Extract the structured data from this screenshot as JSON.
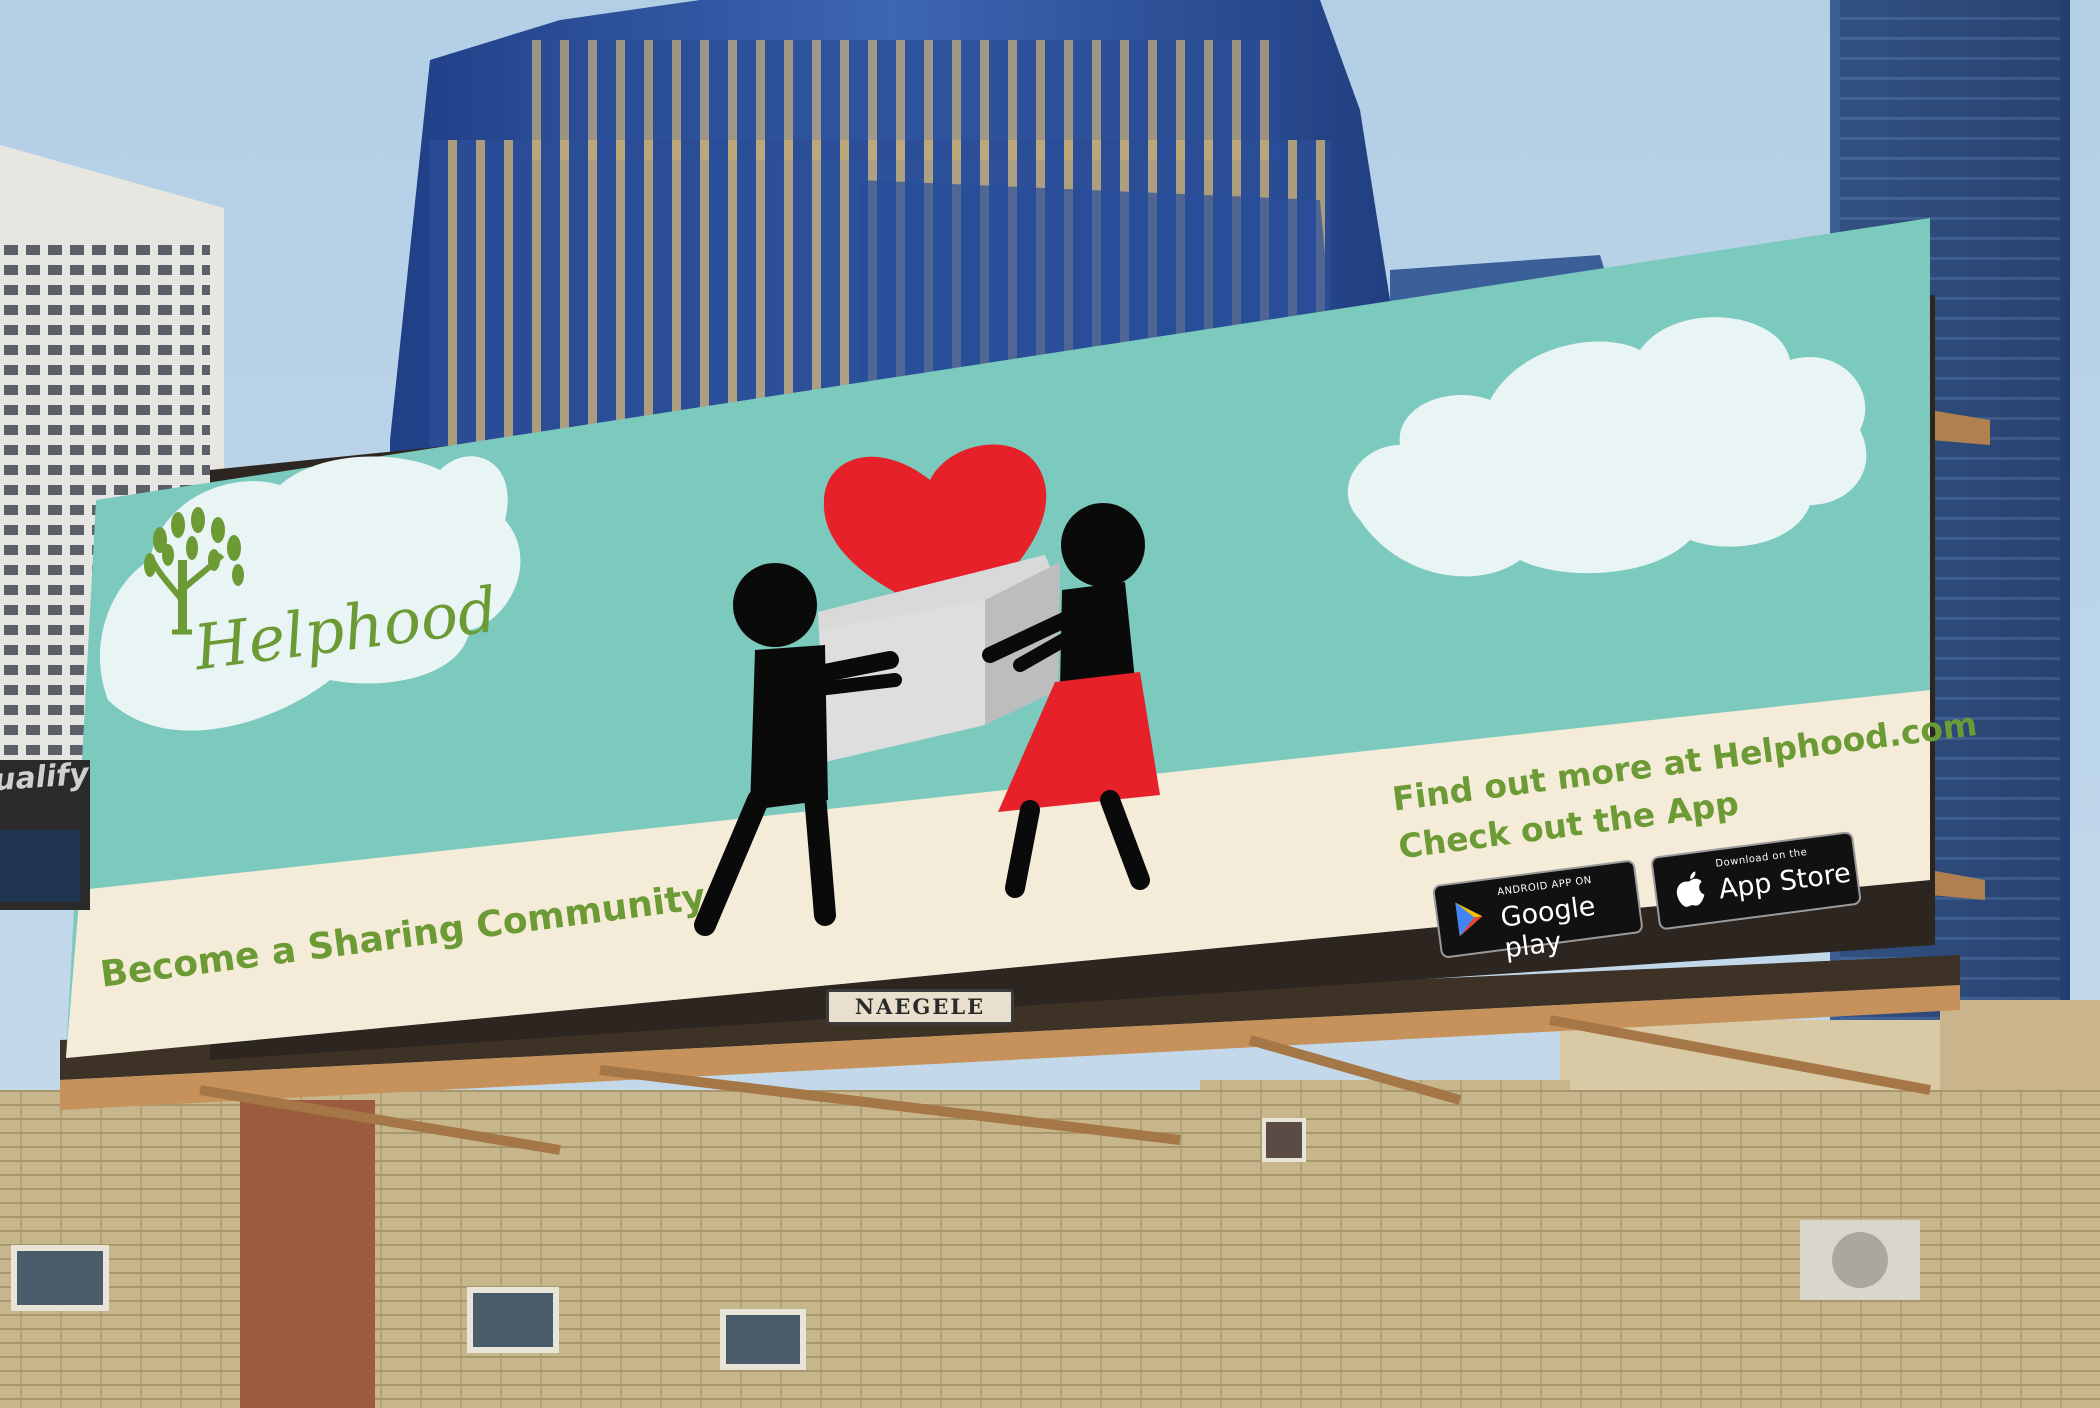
{
  "billboard": {
    "brand": "Helphood",
    "slogan": "Become a Sharing Community",
    "cta_line1": "Find out more at Helphood.com",
    "cta_line2": "Check out the App",
    "google_play": {
      "small": "ANDROID APP ON",
      "big": "Google play"
    },
    "app_store": {
      "small": "Download on the",
      "big": "App Store"
    }
  },
  "signage": {
    "naegele": "NAEGELE",
    "qualify": "ualify"
  },
  "colors": {
    "sky": "#b9d4ea",
    "billboard_teal": "#7ccabd",
    "billboard_cream": "#f5ebd9",
    "brand_green": "#6c9a35",
    "heart_red": "#e6212a"
  },
  "icons": [
    "tree-logo-icon",
    "heart-icon",
    "box-icon",
    "google-play-icon",
    "apple-icon"
  ]
}
